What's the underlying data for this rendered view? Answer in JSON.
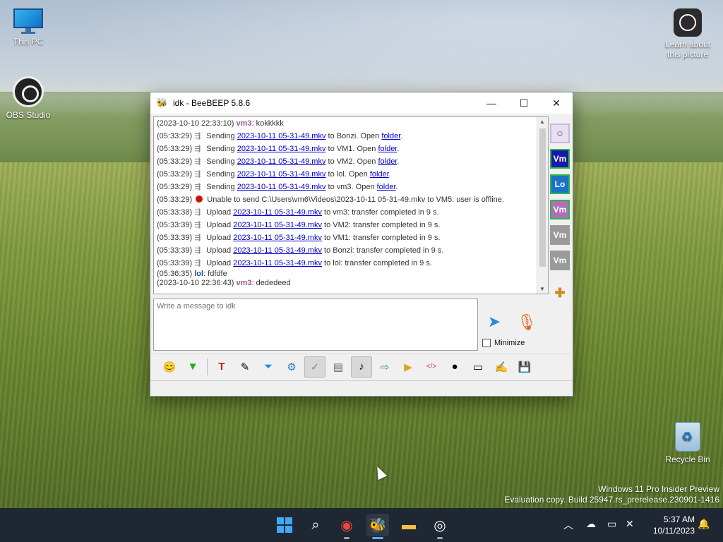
{
  "desktop": {
    "this_pc_label": "This PC",
    "obs_label": "OBS Studio",
    "learn_label_1": "Learn about",
    "learn_label_2": "this picture",
    "recycle_bin_label": "Recycle Bin",
    "watermark_line1": "Windows 11 Pro Insider Preview",
    "watermark_line2": "Evaluation copy. Build 25947.rs_prerelease.230901-1416"
  },
  "window": {
    "title": "idk - BeeBEEP 5.8.6",
    "minimize_glyph": "—",
    "maximize_glyph": "☐",
    "close_glyph": "✕"
  },
  "chat": {
    "lines": [
      {
        "ts": "(2023-10-10 22:33:10)",
        "user": "vm3",
        "text": ": kokkkkk"
      },
      {
        "ts": "(05:33:29)",
        "pre": " Sending ",
        "file": "2023-10-11 05-31-49.mkv",
        "mid": " to Bonzi. Open ",
        "link2": "folder",
        "post": "."
      },
      {
        "ts": "(05:33:29)",
        "pre": " Sending ",
        "file": "2023-10-11 05-31-49.mkv",
        "mid": " to VM1. Open ",
        "link2": "folder",
        "post": "."
      },
      {
        "ts": "(05:33:29)",
        "pre": " Sending ",
        "file": "2023-10-11 05-31-49.mkv",
        "mid": " to VM2. Open ",
        "link2": "folder",
        "post": "."
      },
      {
        "ts": "(05:33:29)",
        "pre": " Sending ",
        "file": "2023-10-11 05-31-49.mkv",
        "mid": " to lol. Open ",
        "link2": "folder",
        "post": "."
      },
      {
        "ts": "(05:33:29)",
        "pre": " Sending ",
        "file": "2023-10-11 05-31-49.mkv",
        "mid": " to vm3. Open ",
        "link2": "folder",
        "post": "."
      },
      {
        "ts": "(05:33:29)",
        "error_text": " Unable to send C:\\Users\\vm6\\Videos\\2023-10-11 05-31-49.mkv to VM5: user is offline."
      },
      {
        "ts": "(05:33:38)",
        "pre": " Upload ",
        "file": "2023-10-11 05-31-49.mkv",
        "mid": " to vm3: transfer completed in 9 s."
      },
      {
        "ts": "(05:33:39)",
        "pre": " Upload ",
        "file": "2023-10-11 05-31-49.mkv",
        "mid": " to VM2: transfer completed in 9 s."
      },
      {
        "ts": "(05:33:39)",
        "pre": " Upload ",
        "file": "2023-10-11 05-31-49.mkv",
        "mid": " to VM1: transfer completed in 9 s."
      },
      {
        "ts": "(05:33:39)",
        "pre": " Upload ",
        "file": "2023-10-11 05-31-49.mkv",
        "mid": " to Bonzi: transfer completed in 9 s."
      },
      {
        "ts": "(05:33:39)",
        "pre": " Upload ",
        "file": "2023-10-11 05-31-49.mkv",
        "mid": " to lol: transfer completed in 9 s."
      },
      {
        "ts": "(05:36:35)",
        "user": "lol",
        "text": ": fdfdfe"
      },
      {
        "ts": "(2023-10-10 22:36:43)",
        "user": "vm3",
        "text": ": dededeed"
      }
    ]
  },
  "userbar": {
    "items": [
      {
        "label": "",
        "color": "#e8e0f0",
        "border": "#c8b8e0"
      },
      {
        "label": "Vm",
        "color": "#1a1aa8",
        "border": "#28b848"
      },
      {
        "label": "Lo",
        "color": "#1a72c8",
        "border": "#28b848"
      },
      {
        "label": "Vm",
        "color": "#b070b8",
        "border": "#28b848"
      },
      {
        "label": "Vm",
        "color": "#9a9a9a",
        "border": "#9a9a9a"
      },
      {
        "label": "Vm",
        "color": "#9a9a9a",
        "border": "#9a9a9a"
      }
    ]
  },
  "input": {
    "placeholder": "Write a message to idk",
    "minimize_label": "Minimize"
  },
  "taskbar": {
    "time": "5:37 AM",
    "date": "10/11/2023"
  }
}
